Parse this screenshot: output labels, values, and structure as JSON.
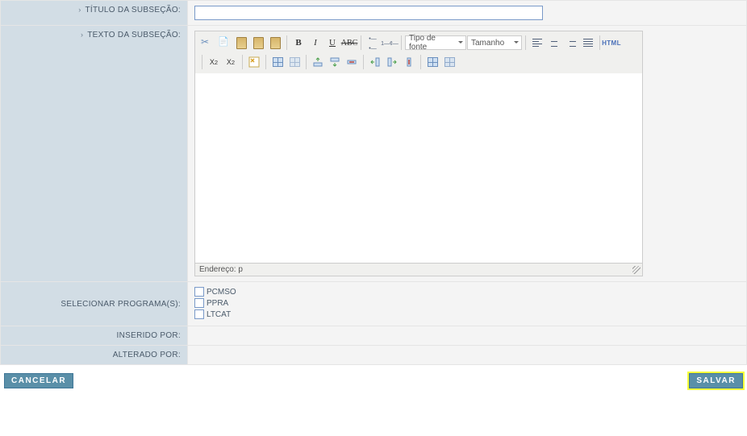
{
  "labels": {
    "titulo": "TÍTULO DA SUBSEÇÃO:",
    "texto": "TEXTO DA SUBSEÇÃO:",
    "programas": "SELECIONAR PROGRAMA(S):",
    "inserido": "INSERIDO POR:",
    "alterado": "ALTERADO POR:"
  },
  "editor": {
    "font_dropdown": "Tipo de fonte",
    "size_dropdown": "Tamanho",
    "html_btn": "HTML",
    "path_label": "Endereço: p"
  },
  "programs": {
    "pcmso": "PCMSO",
    "ppra": "PPRA",
    "ltcat": "LTCAT"
  },
  "buttons": {
    "cancel": "CANCELAR",
    "save": "SALVAR"
  },
  "values": {
    "titulo": "",
    "inserido": "",
    "alterado": ""
  }
}
